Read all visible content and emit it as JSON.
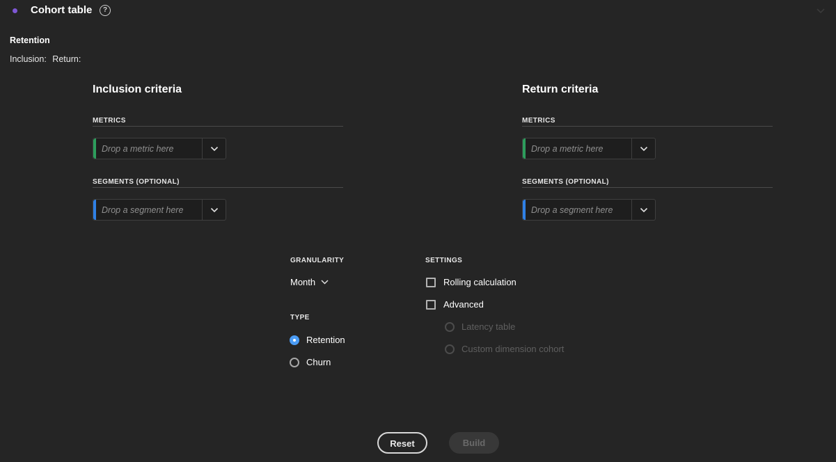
{
  "header": {
    "title": "Cohort table",
    "help_glyph": "?",
    "status_color": "#7e57d4"
  },
  "summary": {
    "title": "Retention",
    "inclusion_label": "Inclusion:",
    "return_label": "Return:"
  },
  "inclusion": {
    "title": "Inclusion criteria",
    "metrics_label": "METRICS",
    "metric_placeholder": "Drop a metric here",
    "segments_label": "SEGMENTS (OPTIONAL)",
    "segment_placeholder": "Drop a segment here"
  },
  "return": {
    "title": "Return criteria",
    "metrics_label": "METRICS",
    "metric_placeholder": "Drop a metric here",
    "segments_label": "SEGMENTS (OPTIONAL)",
    "segment_placeholder": "Drop a segment here"
  },
  "granularity": {
    "label": "GRANULARITY",
    "value": "Month"
  },
  "type": {
    "label": "TYPE",
    "options": [
      {
        "label": "Retention",
        "checked": true
      },
      {
        "label": "Churn",
        "checked": false
      }
    ]
  },
  "settings": {
    "label": "SETTINGS",
    "rolling": "Rolling calculation",
    "advanced": "Advanced",
    "latency": "Latency table",
    "custom_dimension": "Custom dimension cohort"
  },
  "buttons": {
    "reset": "Reset",
    "build": "Build"
  },
  "colors": {
    "metric_accent": "#2d9d5c",
    "segment_accent": "#2f80e5",
    "radio_selected": "#4b9cf5"
  }
}
